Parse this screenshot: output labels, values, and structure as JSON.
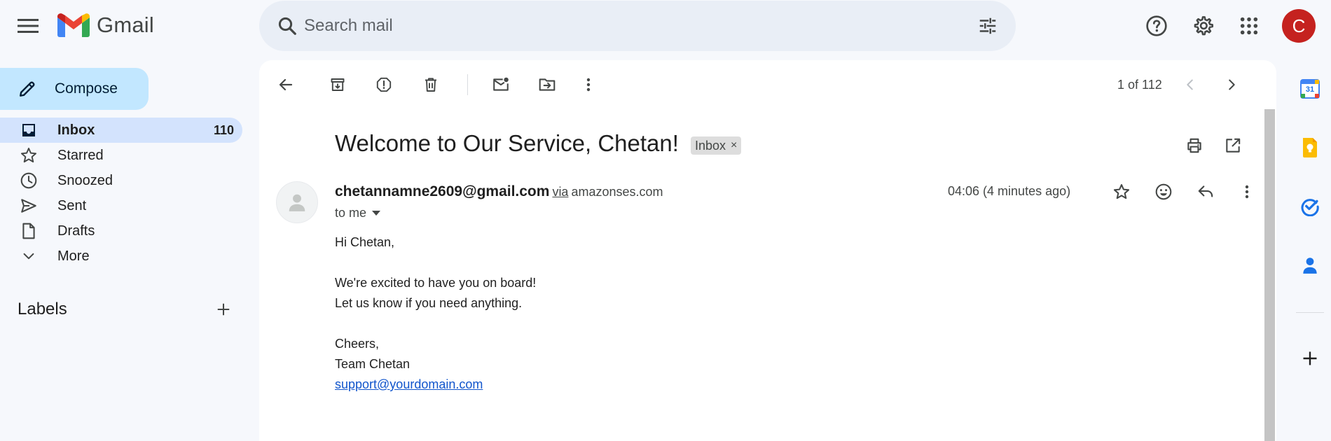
{
  "header": {
    "app_name": "Gmail",
    "search_placeholder": "Search mail",
    "icons": [
      "main-menu-icon",
      "search-icon",
      "search-options-icon",
      "help-icon",
      "settings-icon",
      "google-apps-icon"
    ],
    "account_initial": "C",
    "account_color": "#c5221f"
  },
  "sidebar": {
    "compose_label": "Compose",
    "items": [
      {
        "label": "Inbox",
        "count": "110",
        "icon": "inbox-icon",
        "active": true
      },
      {
        "label": "Starred",
        "icon": "star-icon"
      },
      {
        "label": "Snoozed",
        "icon": "clock-icon"
      },
      {
        "label": "Sent",
        "icon": "send-icon"
      },
      {
        "label": "Drafts",
        "icon": "draft-icon"
      },
      {
        "label": "More",
        "icon": "chevron-down-icon"
      }
    ],
    "labels_title": "Labels"
  },
  "toolbar": {
    "icons": [
      "back-arrow-icon",
      "archive-icon",
      "report-spam-icon",
      "delete-icon",
      "mark-unread-icon",
      "move-to-icon",
      "more-vert-icon"
    ],
    "pager": "1 of 112"
  },
  "email": {
    "subject": "Welcome to Our Service, Chetan!",
    "label_chip": "Inbox",
    "sender_email": "chetannamne2609@gmail.com",
    "via": "via",
    "via_domain": "amazonses.com",
    "recipient": "to me",
    "timestamp": "04:06 (4 minutes ago)",
    "body": {
      "greeting": "Hi Chetan,",
      "line1": "We're excited to have you on board!",
      "line2": "Let us know if you need anything.",
      "signoff": "Cheers,",
      "team": "Team Chetan",
      "link": "support@yourdomain.com"
    }
  },
  "rail": {
    "apps": [
      "calendar-icon",
      "keep-icon",
      "tasks-icon",
      "contacts-icon"
    ],
    "calendar_day": "31"
  },
  "colors": {
    "background": "#f6f8fc",
    "compose": "#c2e7ff",
    "active_nav": "#d3e3fd",
    "link": "#1155cc"
  }
}
